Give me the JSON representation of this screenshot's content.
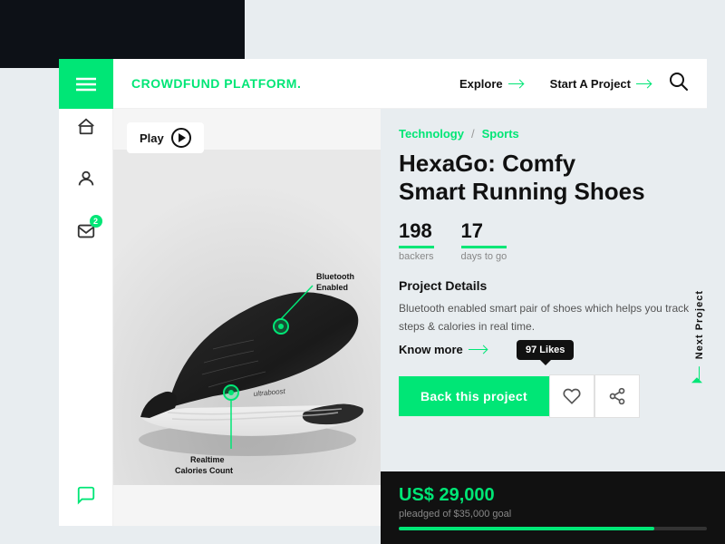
{
  "app": {
    "title": "CROWDFUND PLATFORM",
    "title_dot": ".",
    "dark_corner": true
  },
  "navbar": {
    "logo": "CROWDFUND PLATFORM",
    "explore_label": "Explore",
    "start_project_label": "Start A Project"
  },
  "sidebar": {
    "badge_count": "2",
    "icons": [
      "home",
      "user",
      "notifications",
      "chat"
    ]
  },
  "project": {
    "breadcrumb_tech": "Technology",
    "breadcrumb_sep": "/",
    "breadcrumb_sports": "Sports",
    "title_line1": "HexaGo: Comfy",
    "title_line2": "Smart Running Shoes",
    "backers_count": "198",
    "backers_label": "backers",
    "days_count": "17",
    "days_label": "days to go",
    "details_title": "Project Details",
    "description": "Bluetooth enabled smart pair of shoes which helps you track steps & calories in real time.",
    "know_more": "Know more",
    "back_btn": "Back this project",
    "likes_count": "97 Likes",
    "annotations": [
      {
        "label": "Bluetooth\nEnabled"
      },
      {
        "label": "Realtime\nCalories Count"
      }
    ],
    "play_label": "Play",
    "next_project": "Next Project"
  },
  "funding": {
    "amount": "US$ 29,000",
    "goal_text": "pleadged of $35,000 goal",
    "progress_percent": 83
  }
}
